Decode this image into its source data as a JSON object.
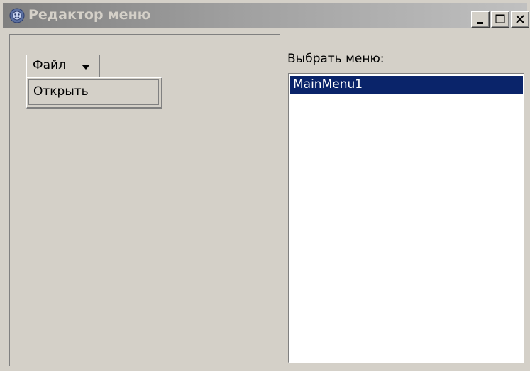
{
  "window": {
    "title": "Редактор меню",
    "icon": "menu-editor-app-icon",
    "buttons": {
      "minimize": "minimize-icon",
      "maximize": "maximize-icon",
      "close": "close-icon"
    }
  },
  "left_pane": {
    "menu_bar": {
      "label": "Файл",
      "indicator_icon": "dropdown-arrow-icon"
    },
    "dropdown": {
      "items": [
        {
          "label": "Открыть"
        }
      ]
    }
  },
  "right_pane": {
    "label": "Выбрать меню:",
    "list": {
      "items": [
        {
          "label": "MainMenu1",
          "selected": true
        }
      ]
    }
  },
  "colors": {
    "selection": "#0a246a",
    "face": "#d4d0c8"
  }
}
